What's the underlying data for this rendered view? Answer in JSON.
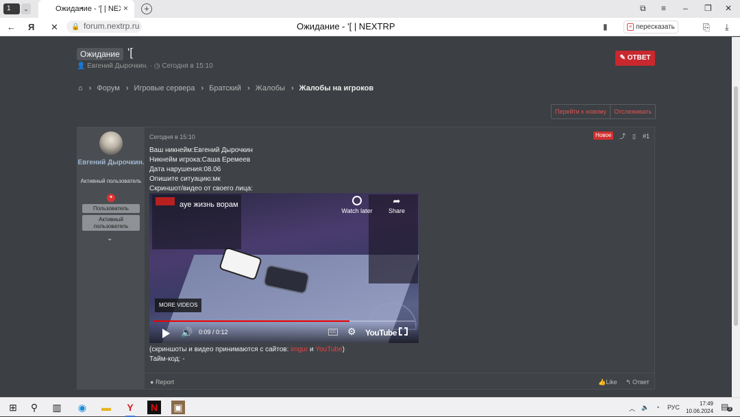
{
  "browser": {
    "tab_counter": "1",
    "tab_title": "Ожидание - '[ | NEXTRP",
    "url": "forum.nextrp.ru",
    "page_title": "Ожидание - '[ | NEXTRP",
    "retell_label": "пересказать"
  },
  "thread": {
    "prefix": "Ожидание",
    "title": "'[",
    "author": "Евгений Дырочкин.",
    "date": "Сегодня в 15:10",
    "reply_label": "ОТВЕТ"
  },
  "breadcrumbs": [
    "Форум",
    "Игровые сервера",
    "Братский",
    "Жалобы",
    "Жалобы на игроков"
  ],
  "actions": {
    "go_new": "Перейти к новому",
    "watch": "Отслеживать"
  },
  "user": {
    "name": "Евгений Дырочкин.",
    "title": "Активный пользователь",
    "banner1": "Пользователь",
    "banner2": "Активный пользователь"
  },
  "post": {
    "date": "Сегодня в 15:10",
    "new_badge": "Новое",
    "number": "#1",
    "lines": [
      "Ваш никнейм:Евгений Дырочкин",
      "Никнейм игрока:Саша Еремеев",
      "Дата нарушения:08.06",
      "Опишите ситуацию:мк",
      "Скриншот/видео от своего лица:"
    ],
    "after_prefix": "(скриншоты и видео принимаются с сайтов: ",
    "link_imgur": "imgur",
    "and_word": " и ",
    "link_youtube": "YouTube",
    "after_suffix": ")",
    "timecode": "Тайм-код: -",
    "report": "Report",
    "like": "Like",
    "answer": "Ответ"
  },
  "video": {
    "title": "ауе жизнь ворам",
    "watch_later": "Watch later",
    "share": "Share",
    "more_videos": "MORE VIDEOS",
    "time": "0:09 / 0:12",
    "brand": "YouTube",
    "progress": 0.75
  },
  "taskbar": {
    "lang": "РУС",
    "time": "17:49",
    "date": "10.06.2024",
    "notif_count": "3"
  }
}
